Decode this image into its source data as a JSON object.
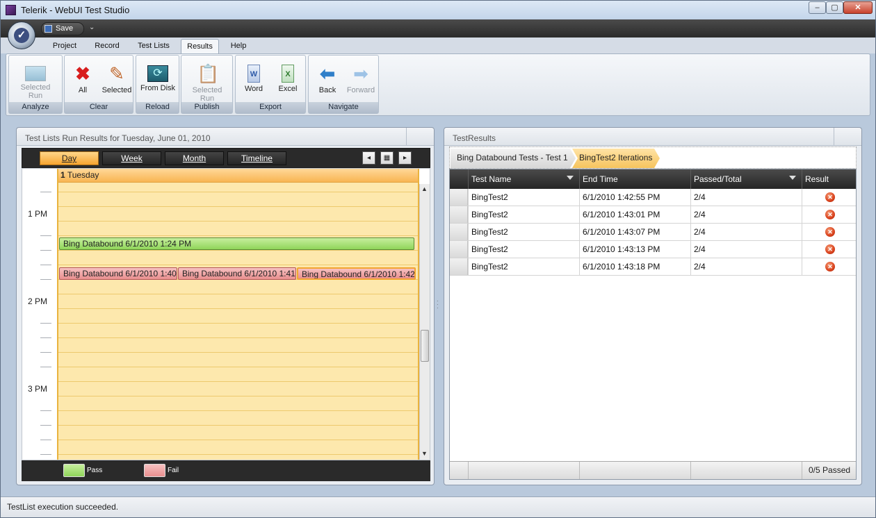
{
  "window": {
    "title": "Telerik - WebUI Test Studio",
    "min": "–",
    "max": "▢",
    "close": "✕"
  },
  "qat": {
    "save_label": "Save",
    "dropdown": "⌄"
  },
  "tabs": [
    "Project",
    "Record",
    "Test Lists",
    "Results",
    "Help"
  ],
  "active_tab": "Results",
  "ribbon": {
    "groups": [
      {
        "label": "Analyze",
        "buttons": [
          {
            "label": "Selected Run",
            "icon": "analyze-run-icon",
            "enabled": false
          }
        ]
      },
      {
        "label": "Clear",
        "buttons": [
          {
            "label": "All",
            "icon": "red-x-icon",
            "enabled": true
          },
          {
            "label": "Selected",
            "icon": "clear-selected-icon",
            "enabled": true
          }
        ]
      },
      {
        "label": "Reload",
        "buttons": [
          {
            "label": "From Disk",
            "icon": "reload-disk-icon",
            "enabled": true
          }
        ]
      },
      {
        "label": "Publish",
        "buttons": [
          {
            "label": "Selected Run",
            "icon": "publish-clipboard-icon",
            "enabled": false
          }
        ]
      },
      {
        "label": "Export",
        "buttons": [
          {
            "label": "Word",
            "icon": "word-doc-icon",
            "enabled": true
          },
          {
            "label": "Excel",
            "icon": "excel-doc-icon",
            "enabled": true
          }
        ]
      },
      {
        "label": "Navigate",
        "buttons": [
          {
            "label": "Back",
            "icon": "back-arrow-icon",
            "enabled": true
          },
          {
            "label": "Forward",
            "icon": "forward-arrow-icon",
            "enabled": false
          }
        ]
      }
    ]
  },
  "left_panel": {
    "title": "Test Lists Run Results for Tuesday, June 01, 2010",
    "views": [
      "Day",
      "Week",
      "Month",
      "Timeline"
    ],
    "active_view": "Day",
    "nav": {
      "prev": "◂",
      "today": "▦",
      "next": "▸"
    },
    "day_header_num": "1",
    "day_header_name": "Tuesday",
    "time_labels": [
      "1 PM",
      "2 PM",
      "3 PM"
    ],
    "appointments": [
      {
        "text": "Bing Databound 6/1/2010 1:24 PM",
        "status": "pass"
      },
      {
        "text": "Bing Databound 6/1/2010 1:40",
        "status": "fail"
      },
      {
        "text": "Bing Databound 6/1/2010 1:41",
        "status": "fail"
      },
      {
        "text": "Bing Databound 6/1/2010 1:42",
        "status": "fail"
      }
    ],
    "legend": [
      {
        "label": "Pass",
        "color": "#a5e07a"
      },
      {
        "label": "Fail",
        "color": "#f0a5a5"
      }
    ]
  },
  "right_panel": {
    "title": "TestResults",
    "breadcrumbs": [
      "Bing Databound Tests - Test 1",
      "BingTest2 Iterations"
    ],
    "columns": [
      "Test Name",
      "End Time",
      "Passed/Total",
      "Result"
    ],
    "rows": [
      {
        "name": "BingTest2",
        "end": "6/1/2010 1:42:55 PM",
        "passed": "2/4",
        "result": "fail"
      },
      {
        "name": "BingTest2",
        "end": "6/1/2010 1:43:01 PM",
        "passed": "2/4",
        "result": "fail"
      },
      {
        "name": "BingTest2",
        "end": "6/1/2010 1:43:07 PM",
        "passed": "2/4",
        "result": "fail"
      },
      {
        "name": "BingTest2",
        "end": "6/1/2010 1:43:13 PM",
        "passed": "2/4",
        "result": "fail"
      },
      {
        "name": "BingTest2",
        "end": "6/1/2010 1:43:18 PM",
        "passed": "2/4",
        "result": "fail"
      }
    ],
    "footer": "0/5 Passed"
  },
  "status": "TestList execution succeeded.",
  "colors": {
    "accent": "#f7a531",
    "pass": "#8fd55a",
    "fail": "#e98f8f",
    "day_bg": "#fde8ad"
  }
}
